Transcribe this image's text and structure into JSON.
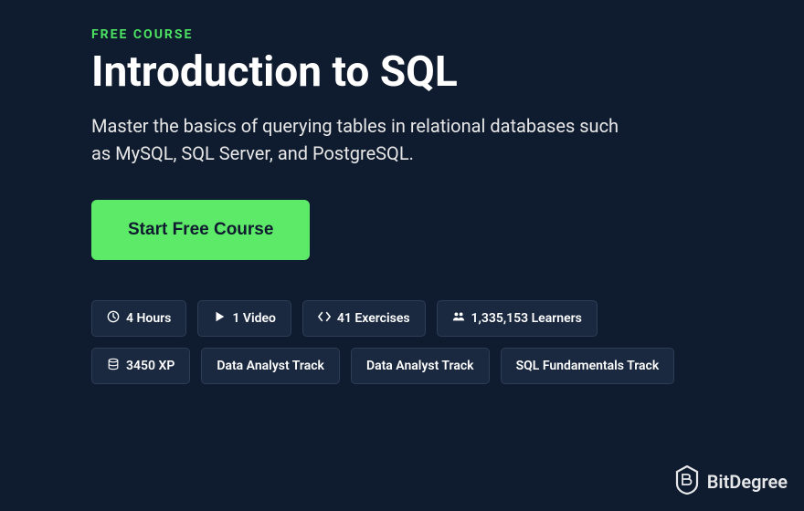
{
  "course_label": "FREE COURSE",
  "title": "Introduction to SQL",
  "description": "Master the basics of querying tables in relational databases such as MySQL, SQL Server, and PostgreSQL.",
  "cta_label": "Start Free Course",
  "chips": {
    "hours": "4 Hours",
    "video": "1 Video",
    "exercises": "41 Exercises",
    "learners": "1,335,153 Learners",
    "xp": "3450 XP",
    "track1": "Data Analyst Track",
    "track2": "Data Analyst Track",
    "track3": "SQL Fundamentals Track"
  },
  "watermark": "BitDegree"
}
